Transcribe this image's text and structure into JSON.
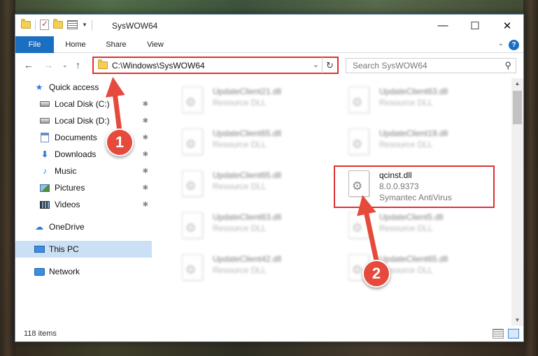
{
  "window": {
    "title": "SysWOW64",
    "minimize_glyph": "—",
    "maximize_glyph": "☐",
    "close_glyph": "✕"
  },
  "ribbon": {
    "tabs": [
      {
        "label": "File"
      },
      {
        "label": "Home"
      },
      {
        "label": "Share"
      },
      {
        "label": "View"
      }
    ],
    "help_glyph": "?"
  },
  "address": {
    "path": "C:\\Windows\\SysWOW64",
    "search_placeholder": "Search SysWOW64"
  },
  "sidebar": {
    "items": [
      {
        "label": "Quick access",
        "icon": "star-icon"
      },
      {
        "label": "Local Disk (C:)",
        "icon": "drive-icon",
        "pinned": true
      },
      {
        "label": "Local Disk (D:)",
        "icon": "drive-icon",
        "pinned": true
      },
      {
        "label": "Documents",
        "icon": "documents-icon",
        "pinned": true
      },
      {
        "label": "Downloads",
        "icon": "download-icon",
        "pinned": true
      },
      {
        "label": "Music",
        "icon": "music-icon",
        "pinned": true
      },
      {
        "label": "Pictures",
        "icon": "pictures-icon",
        "pinned": true
      },
      {
        "label": "Videos",
        "icon": "videos-icon",
        "pinned": true
      },
      {
        "label": "OneDrive",
        "icon": "cloud-icon"
      },
      {
        "label": "This PC",
        "icon": "computer-icon",
        "selected": true
      },
      {
        "label": "Network",
        "icon": "network-icon"
      }
    ]
  },
  "files": [
    {
      "name": "UpdateClient21.dll",
      "type": "Resource DLL"
    },
    {
      "name": "UpdateClient63.dll",
      "type": "Resource DLL"
    },
    {
      "name": "UpdateClient65.dll",
      "type": "Resource DLL"
    },
    {
      "name": "UpdateClient19.dll",
      "type": "Resource DLL"
    },
    {
      "name": "UpdateClient65.dll",
      "type": "Resource DLL"
    },
    {
      "name": "qcinst.dll",
      "version": "8.0.0.9373",
      "company": "Symantec AntiVirus",
      "highlighted": true
    },
    {
      "name": "UpdateClient63.dll",
      "type": "Resource DLL"
    },
    {
      "name": "UpdateClient5.dll",
      "type": "Resource DLL"
    },
    {
      "name": "UpdateClient42.dll",
      "type": "Resource DLL"
    },
    {
      "name": "UpdateClient65.dll",
      "type": "Resource DLL"
    }
  ],
  "status": {
    "item_count": "118 items"
  },
  "annotations": {
    "badge1": "1",
    "badge2": "2",
    "color": "#e54a3c"
  }
}
